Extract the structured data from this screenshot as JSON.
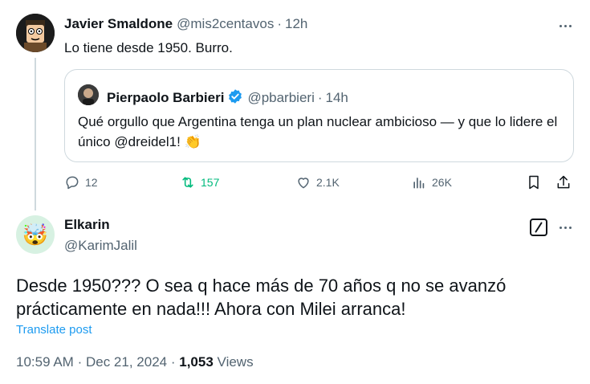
{
  "quoted_reply": {
    "author_name": "Javier Smaldone",
    "handle": "@mis2centavos",
    "separator": "·",
    "time": "12h",
    "text": "Lo tiene desde 1950. Burro.",
    "quote": {
      "author_name": "Pierpaolo Barbieri",
      "handle": "@pbarbieri",
      "separator": "·",
      "time": "14h",
      "text": "Qué orgullo que Argentina tenga un plan nuclear ambicioso — y que lo lidere el único @dreidel1!",
      "emoji": "👏"
    },
    "actions": {
      "replies": "12",
      "reposts": "157",
      "likes": "2.1K",
      "views": "26K"
    }
  },
  "main_post": {
    "author_name": "Elkarin",
    "handle": "@KarimJalil",
    "avatar_emoji": "🤯",
    "text": "Desde 1950??? O sea q hace más de 70 años q no se avanzó prácticamente en nada!!! Ahora con Milei arranca!",
    "translate_label": "Translate post",
    "time": "10:59 AM",
    "separator": "·",
    "date": "Dec 21, 2024",
    "views_count": "1,053",
    "views_label": "Views"
  },
  "colors": {
    "text": "#0f1419",
    "secondary": "#536471",
    "accent_blue": "#1d9bf0",
    "repost_green": "#00ba7c",
    "border": "#cfd9de"
  }
}
